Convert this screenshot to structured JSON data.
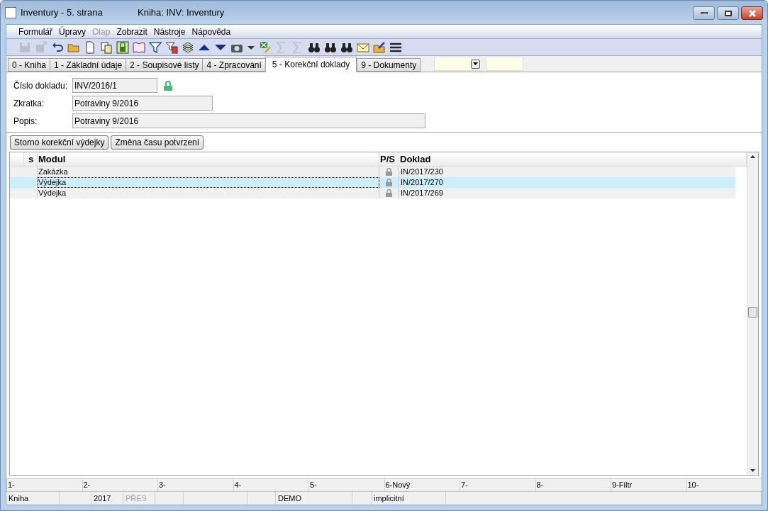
{
  "window": {
    "title": "Inventury - 5. strana",
    "subtitle": "Kniha: INV: Inventury"
  },
  "menu": [
    {
      "label": "Formulář",
      "disabled": false
    },
    {
      "label": "Úpravy",
      "disabled": false
    },
    {
      "label": "Olap",
      "disabled": true
    },
    {
      "label": "Zobrazit",
      "disabled": false
    },
    {
      "label": "Nástroje",
      "disabled": false
    },
    {
      "label": "Nápověda",
      "disabled": false
    }
  ],
  "toolbar": [
    {
      "kind": "save",
      "disabled": true
    },
    {
      "kind": "save-export",
      "disabled": true
    },
    {
      "kind": "undo",
      "disabled": false
    },
    {
      "kind": "folder",
      "disabled": false
    },
    {
      "kind": "page",
      "disabled": false
    },
    {
      "kind": "copy",
      "disabled": false
    },
    {
      "kind": "lock",
      "disabled": false
    },
    {
      "kind": "book",
      "disabled": false
    },
    {
      "kind": "filter",
      "disabled": false
    },
    {
      "kind": "filter-page",
      "disabled": false
    },
    {
      "kind": "stack",
      "disabled": false
    },
    {
      "kind": "up",
      "disabled": false
    },
    {
      "kind": "down",
      "disabled": false
    },
    {
      "kind": "camera",
      "disabled": false
    },
    {
      "kind": "caret",
      "disabled": false
    },
    {
      "kind": "sheet",
      "disabled": false
    },
    {
      "kind": "sigma",
      "disabled": true
    },
    {
      "kind": "sigma",
      "disabled": true
    },
    {
      "kind": "binoculars",
      "disabled": false
    },
    {
      "kind": "binoculars",
      "disabled": false
    },
    {
      "kind": "binoculars",
      "disabled": false
    },
    {
      "kind": "mail",
      "disabled": false
    },
    {
      "kind": "folder-edit",
      "disabled": false
    },
    {
      "kind": "menu",
      "disabled": false
    }
  ],
  "tabs": [
    {
      "label": "0 - Kniha",
      "selected": false
    },
    {
      "label": "1 - Základní údaje",
      "selected": false
    },
    {
      "label": "2 - Soupisové listy",
      "selected": false
    },
    {
      "label": "4 - Zpracování",
      "selected": false
    },
    {
      "label": "5 - Korekční doklady",
      "selected": true
    },
    {
      "label": "9 - Dokumenty",
      "selected": false
    }
  ],
  "fields": [
    {
      "label": "Číslo dokladu:",
      "value": "INV/2016/1",
      "locked": true
    },
    {
      "label": "Zkratka:",
      "value": "Potraviny 9/2016",
      "locked": false
    },
    {
      "label": "Popis:",
      "value": "Potraviny 9/2016",
      "locked": false
    }
  ],
  "buttons": [
    "Storno korekční výdejky",
    "Změna času potvrzení"
  ],
  "table": {
    "columns": [
      "s",
      "Modul",
      "P/S",
      "Doklad"
    ],
    "rows": [
      {
        "modul": "Zakázka",
        "locked": true,
        "doklad": "IN/2017/230",
        "selected": false
      },
      {
        "modul": "Výdejka",
        "locked": true,
        "doklad": "IN/2017/270",
        "selected": true
      },
      {
        "modul": "Výdejka",
        "locked": true,
        "doklad": "IN/2017/269",
        "selected": false
      }
    ]
  },
  "function_keys": [
    "1-",
    "2-",
    "3-",
    "4-",
    "5-",
    "6-Nový",
    "7-",
    "8-",
    "9-Filtr",
    "10-"
  ],
  "status_bar": [
    {
      "text": "Kniha",
      "disabled": false
    },
    {
      "text": "2017",
      "disabled": false
    },
    {
      "text": "PŘES",
      "disabled": true
    },
    {
      "text": "DEMO",
      "disabled": false
    },
    {
      "text": "implicitní",
      "disabled": false
    }
  ]
}
